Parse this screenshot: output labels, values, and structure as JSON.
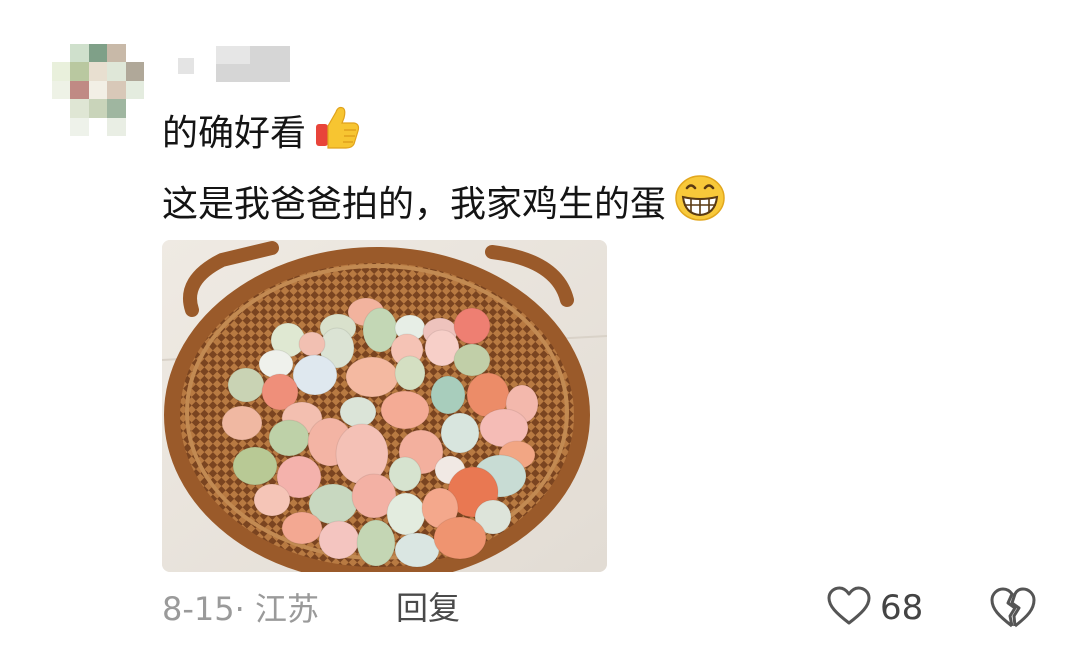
{
  "comment": {
    "user": {
      "avatar": "avatar-mosaic",
      "name_blurred": true
    },
    "lines": [
      "的确好看",
      "这是我爸爸拍的，我家鸡生的蛋"
    ],
    "emojis": [
      "thumbs-up-emoji",
      "grinning-emoji"
    ],
    "image": "photo-basket-of-eggs",
    "date": "8-15",
    "location": "江苏",
    "reply_label": "回复",
    "like_count": "68",
    "icons": [
      "heart-icon",
      "broken-heart-icon"
    ]
  },
  "colors": {
    "text": "#141414",
    "meta": "#9a9a9a",
    "icon": "#555555",
    "basket": "#9a5a2a"
  }
}
